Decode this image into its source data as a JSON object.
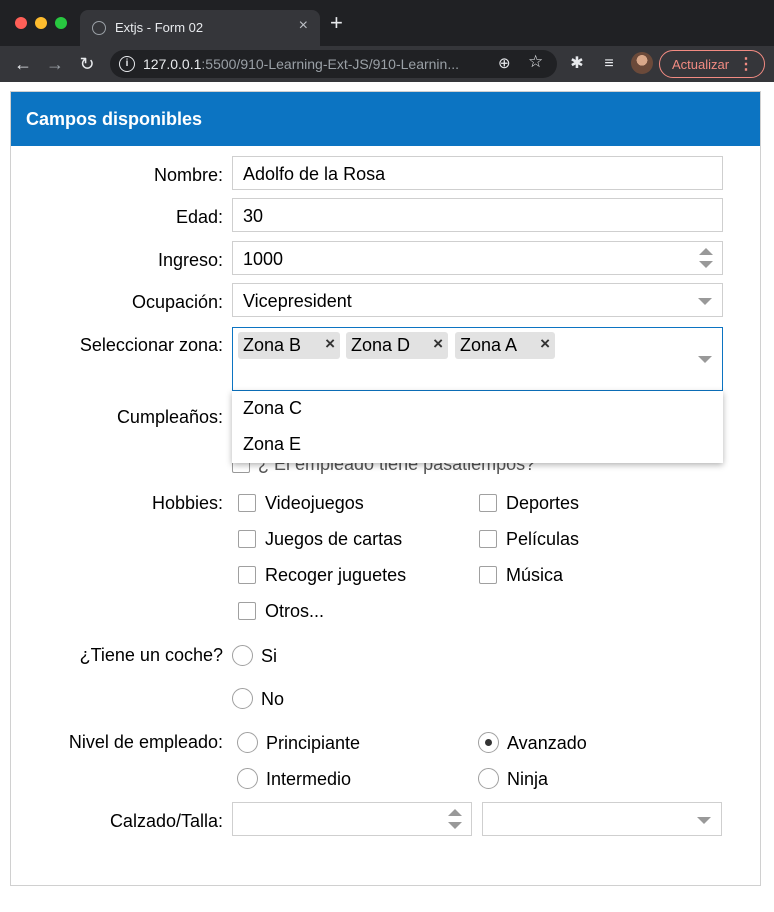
{
  "browser": {
    "tab_title": "Extjs - Form 02",
    "url_host": "127.0.0.1",
    "url_rest": ":5500/910-Learning-Ext-JS/910-Learnin...",
    "update_label": "Actualizar"
  },
  "form": {
    "panel_title": "Campos disponibles",
    "nombre": {
      "label": "Nombre:",
      "value": "Adolfo de la Rosa"
    },
    "edad": {
      "label": "Edad:",
      "value": "30"
    },
    "ingreso": {
      "label": "Ingreso:",
      "value": "1000"
    },
    "ocupacion": {
      "label": "Ocupación:",
      "value": "Vicepresident"
    },
    "zona": {
      "label": "Seleccionar zona:",
      "tags": [
        "Zona B",
        "Zona D",
        "Zona A"
      ],
      "dropdown": [
        "Zona C",
        "Zona E"
      ]
    },
    "cumpleanos": {
      "label": "Cumpleaños:"
    },
    "pasatiempos": {
      "label": "¿ El empleado tiene pasatiempos?"
    },
    "hobbies": {
      "label": "Hobbies:",
      "items": [
        "Videojuegos",
        "Deportes",
        "Juegos de cartas",
        "Películas",
        "Recoger juguetes",
        "Música",
        "Otros..."
      ]
    },
    "coche": {
      "label": "¿Tiene un coche?",
      "options": [
        "Si",
        "No"
      ]
    },
    "nivel": {
      "label": "Nivel de empleado:",
      "options": [
        "Principiante",
        "Avanzado",
        "Intermedio",
        "Ninja"
      ],
      "selected": "Avanzado"
    },
    "calzado": {
      "label": "Calzado/Talla:"
    }
  }
}
